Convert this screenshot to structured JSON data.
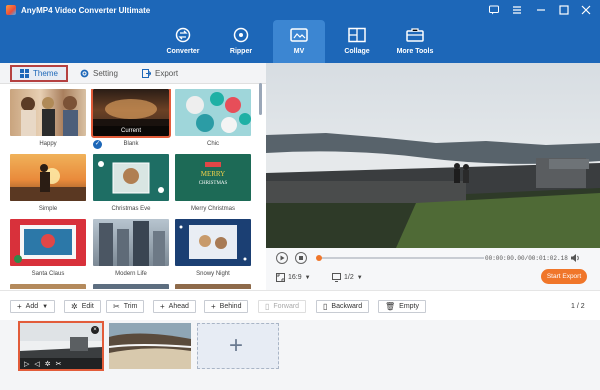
{
  "app": {
    "title": "AnyMP4 Video Converter Ultimate"
  },
  "nav": {
    "tabs": [
      {
        "label": "Converter",
        "icon": "converter-icon"
      },
      {
        "label": "Ripper",
        "icon": "disc-icon"
      },
      {
        "label": "MV",
        "icon": "mv-icon",
        "active": true
      },
      {
        "label": "Collage",
        "icon": "collage-icon"
      },
      {
        "label": "More Tools",
        "icon": "toolbox-icon"
      }
    ]
  },
  "subtabs": {
    "theme": "Theme",
    "setting": "Setting",
    "export": "Export"
  },
  "themes": [
    {
      "name": "Happy"
    },
    {
      "name": "Blank",
      "selected": true,
      "badge": "Current"
    },
    {
      "name": "Chic"
    },
    {
      "name": "Simple"
    },
    {
      "name": "Christmas Eve"
    },
    {
      "name": "Merry Christmas"
    },
    {
      "name": "Santa Claus"
    },
    {
      "name": "Modern Life"
    },
    {
      "name": "Snowy Night"
    }
  ],
  "theme_thumb_text": {
    "merry": "MERRY\nCHRISTMAS"
  },
  "player": {
    "timecode": "00:00:00.00/00:01:02.18",
    "progress": 0.0,
    "aspect": "16:9",
    "page_ratio": "1/2",
    "start_export": "Start Export"
  },
  "toolbar": {
    "add": "Add",
    "edit": "Edit",
    "trim": "Trim",
    "ahead": "Ahead",
    "behind": "Behind",
    "forward": "Forward",
    "backward": "Backward",
    "empty": "Empty",
    "page": "1 / 2"
  },
  "colors": {
    "brand": "#1d67b8",
    "accent": "#f0762a",
    "selection": "#e25c3a",
    "highlight_border": "#b54141"
  }
}
